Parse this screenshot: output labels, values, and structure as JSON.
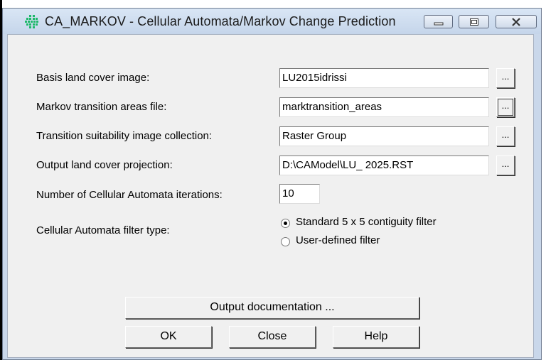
{
  "window": {
    "title": "CA_MARKOV - Cellular Automata/Markov Change Prediction",
    "icon": "grid-app-icon",
    "controls": [
      "minimize-icon",
      "restore-icon",
      "close-icon"
    ]
  },
  "fields": [
    {
      "label": "Basis land cover image:",
      "value": "LU2015idrissi",
      "browse": "..."
    },
    {
      "label": "Markov transition areas file:",
      "value": "marktransition_areas",
      "browse": "..."
    },
    {
      "label": "Transition suitability image collection:",
      "value": "Raster Group",
      "browse": "..."
    },
    {
      "label": "Output land cover projection:",
      "value": "D:\\CAModel\\LU_ 2025.RST",
      "browse": "..."
    }
  ],
  "iterations": {
    "label": "Number of Cellular Automata iterations:",
    "value": "10"
  },
  "filter": {
    "label": "Cellular Automata filter type:",
    "options": [
      {
        "label": "Standard 5 x 5 contiguity filter",
        "selected": true
      },
      {
        "label": "User-defined filter",
        "selected": false
      }
    ]
  },
  "buttons": {
    "output_doc": "Output documentation ...",
    "ok": "OK",
    "close": "Close",
    "help": "Help"
  }
}
